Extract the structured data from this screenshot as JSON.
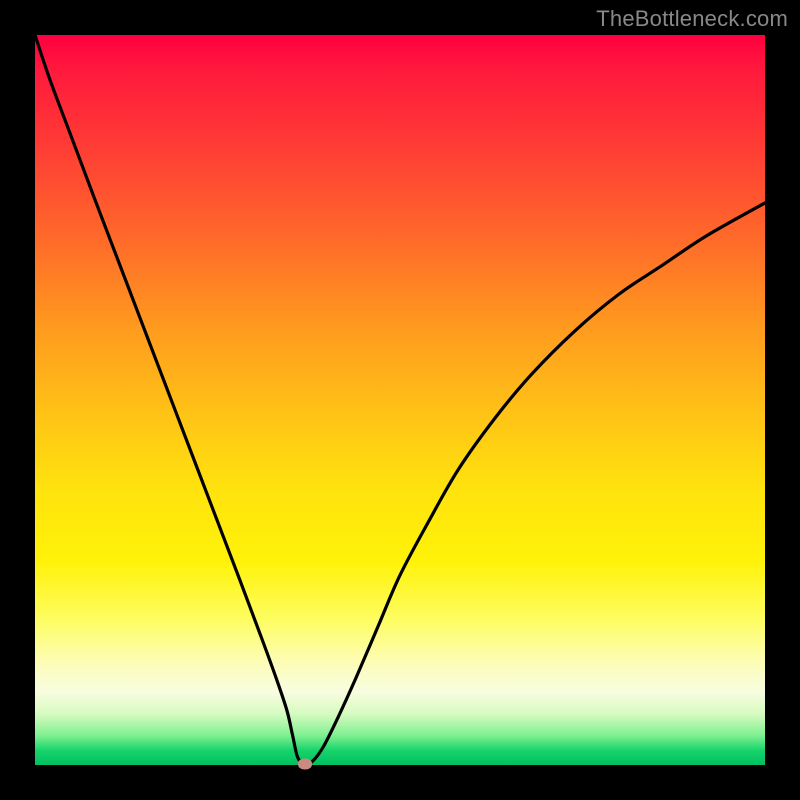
{
  "watermark": "TheBottleneck.com",
  "colors": {
    "frame_bg": "#000000",
    "curve": "#000000",
    "marker": "#c98b80",
    "gradient_top": "#ff0040",
    "gradient_bottom": "#00c060"
  },
  "chart_data": {
    "type": "line",
    "title": "",
    "xlabel": "",
    "ylabel": "",
    "xlim": [
      0,
      100
    ],
    "ylim": [
      0,
      100
    ],
    "grid": false,
    "legend": false,
    "series": [
      {
        "name": "bottleneck-curve",
        "x": [
          0,
          2,
          5,
          8,
          12,
          16,
          20,
          24,
          28,
          31,
          33,
          34.5,
          35.3,
          36,
          37,
          38,
          39.5,
          41.5,
          44,
          47,
          50,
          54,
          58,
          63,
          68,
          74,
          80,
          86,
          92,
          100
        ],
        "y": [
          100,
          94,
          86,
          78,
          67.5,
          57,
          46.5,
          36,
          25.5,
          17.5,
          12,
          7.5,
          4,
          1,
          0.2,
          0.5,
          2.5,
          6.5,
          12,
          19,
          26,
          33.5,
          40.5,
          47.5,
          53.5,
          59.5,
          64.5,
          68.5,
          72.5,
          77
        ]
      }
    ],
    "marker": {
      "x": 37,
      "y": 0.2
    }
  }
}
